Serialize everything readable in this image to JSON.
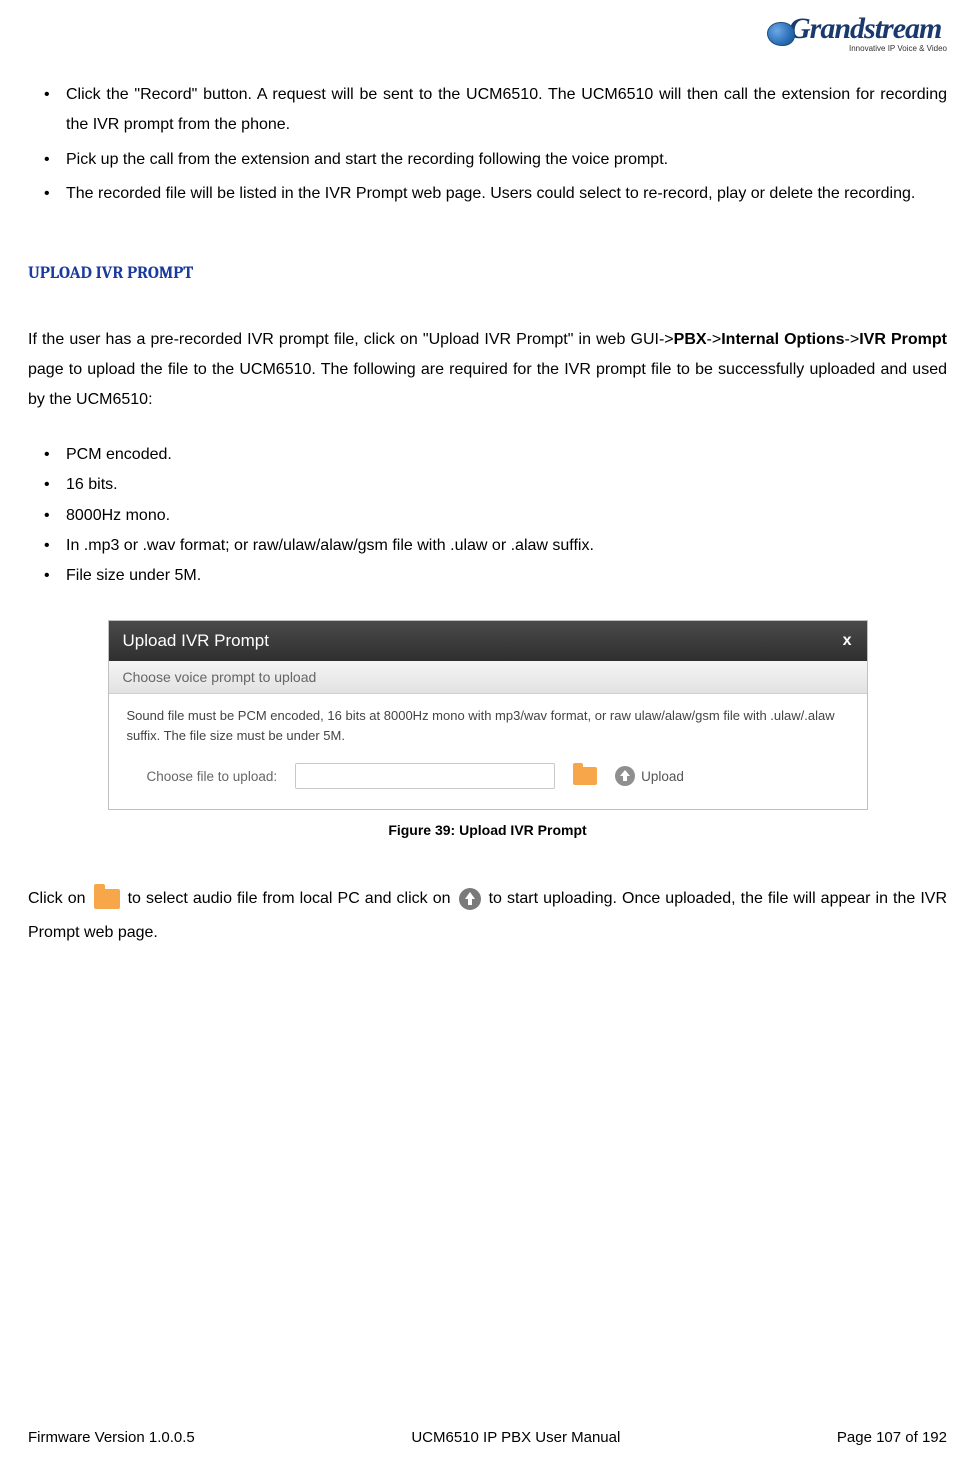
{
  "logo": {
    "brand": "Grandstream",
    "tagline": "Innovative IP Voice & Video"
  },
  "intro_list": [
    "Click the \"Record\" button. A request will be sent to the UCM6510. The UCM6510 will then call the extension for recording the IVR prompt from the phone.",
    "Pick up the call from the extension and start the recording following the voice prompt.",
    "The recorded file will be listed in the IVR Prompt web page. Users could select to re-record, play or delete the recording."
  ],
  "section_heading": "UPLOAD IVR PROMPT",
  "para1": {
    "t1": "If the user has a pre-recorded IVR prompt file, click on \"Upload IVR Prompt\" in web GUI->",
    "b1": "PBX",
    "t2": "->",
    "b2": "Internal Options",
    "t3": "->",
    "b3": "IVR Prompt",
    "t4": " page to upload the file to the UCM6510. The following are required for the IVR prompt file to be successfully uploaded and used by the UCM6510:"
  },
  "req_list": [
    "PCM encoded.",
    "16 bits.",
    "8000Hz mono.",
    "In .mp3 or .wav format; or raw/ulaw/alaw/gsm file with .ulaw or .alaw suffix.",
    "File size under 5M."
  ],
  "dialog": {
    "title": "Upload IVR Prompt",
    "close": "x",
    "subtitle": "Choose voice prompt to upload",
    "desc": "Sound file must be PCM encoded, 16 bits at 8000Hz mono with mp3/wav format, or raw ulaw/alaw/gsm file with .ulaw/.alaw suffix. The file size must be under 5M.",
    "row_label": "Choose file to upload:",
    "upload_label": "Upload"
  },
  "figure_caption": "Figure 39: Upload IVR Prompt",
  "para2": {
    "t1": "Click on ",
    "t2": " to select audio file from local PC and click on ",
    "t3": " to start uploading. Once uploaded, the file will appear in the IVR Prompt web page."
  },
  "footer": {
    "left": "Firmware Version 1.0.0.5",
    "center": "UCM6510 IP PBX User Manual",
    "right": "Page 107 of 192"
  }
}
